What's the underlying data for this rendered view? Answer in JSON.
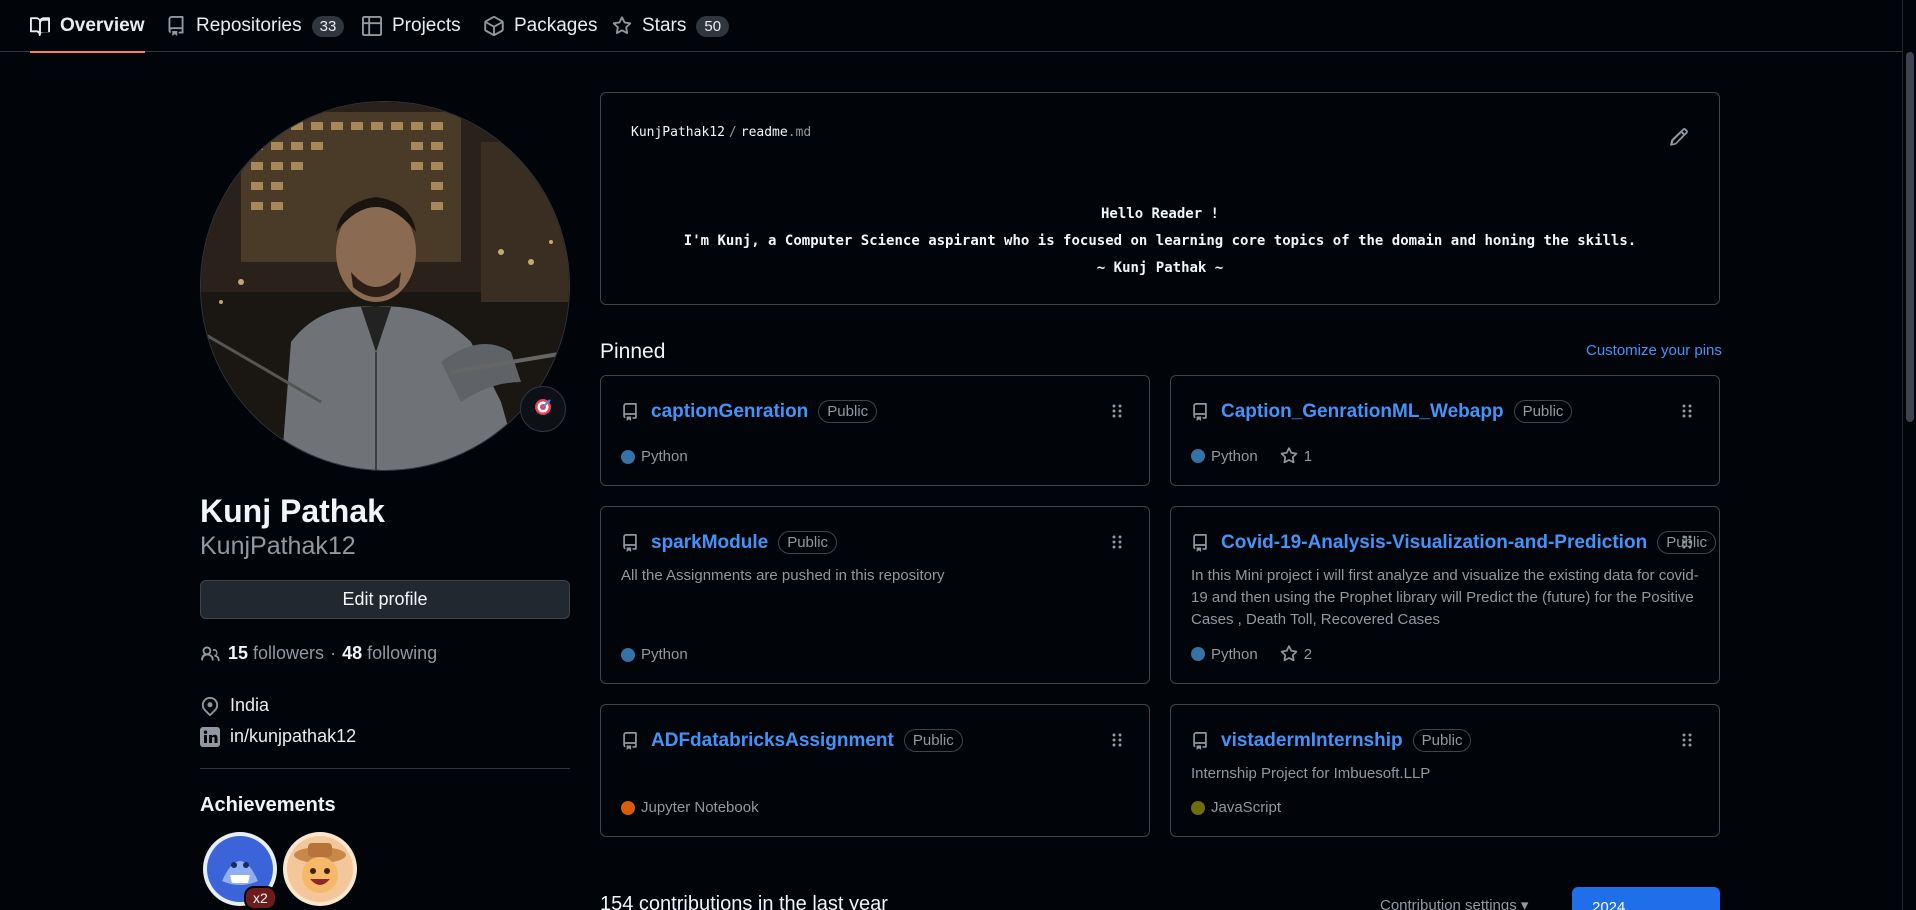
{
  "tabs": [
    {
      "label": "Overview",
      "counter": null,
      "active": true
    },
    {
      "label": "Repositories",
      "counter": "33",
      "active": false
    },
    {
      "label": "Projects",
      "counter": null,
      "active": false
    },
    {
      "label": "Packages",
      "counter": null,
      "active": false
    },
    {
      "label": "Stars",
      "counter": "50",
      "active": false
    }
  ],
  "profile": {
    "name": "Kunj Pathak",
    "login": "KunjPathak12",
    "edit_label": "Edit profile",
    "followers_count": "15",
    "followers_label": "followers",
    "dot": "·",
    "following_count": "48",
    "following_label": "following",
    "location": "India",
    "linkedin": "in/kunjpathak12"
  },
  "achievements": {
    "title": "Achievements",
    "multiplier": "x2"
  },
  "readme": {
    "owner": "KunjPathak12",
    "sep": "/",
    "file": "readme",
    "ext": ".md",
    "line1": "Hello Reader !",
    "line2": "I'm Kunj, a Computer Science aspirant who is focused on learning core topics of the domain and honing the skills.",
    "line3": "~ Kunj Pathak ~"
  },
  "pinned": {
    "title": "Pinned",
    "customize": "Customize your pins",
    "cards": [
      {
        "name": "captionGenration",
        "visibility": "Public",
        "description": "",
        "language": "Python",
        "lang_color": "#3572A5",
        "stars": ""
      },
      {
        "name": "Caption_GenrationML_Webapp",
        "visibility": "Public",
        "description": "",
        "language": "Python",
        "lang_color": "#3572A5",
        "stars": "1"
      },
      {
        "name": "sparkModule",
        "visibility": "Public",
        "description": "All the Assignments are pushed in this repository",
        "language": "Python",
        "lang_color": "#3572A5",
        "stars": ""
      },
      {
        "name": "Covid-19-Analysis-Visualization-and-Prediction",
        "visibility": "Public",
        "description": "In this Mini project i will first analyze and visualize the existing data for covid-19 and then using the Prophet library will Predict the (future) for the Positive Cases , Death Toll, Recovered Cases",
        "language": "Python",
        "lang_color": "#3572A5",
        "stars": "2"
      },
      {
        "name": "ADFdatabricksAssignment",
        "visibility": "Public",
        "description": "",
        "language": "Jupyter Notebook",
        "lang_color": "#DA5B0B",
        "stars": ""
      },
      {
        "name": "vistadermInternship",
        "visibility": "Public",
        "description": "Internship Project for Imbuesoft.LLP",
        "language": "JavaScript",
        "lang_color": "#6e6c0b",
        "stars": ""
      }
    ]
  },
  "contributions": {
    "title": "154 contributions in the last year",
    "settings": "Contribution settings ▾",
    "year": "2024"
  },
  "colors": {
    "accent": "#4493f8",
    "active_tab_underline": "#f78166",
    "year_button": "#1f6feb"
  }
}
